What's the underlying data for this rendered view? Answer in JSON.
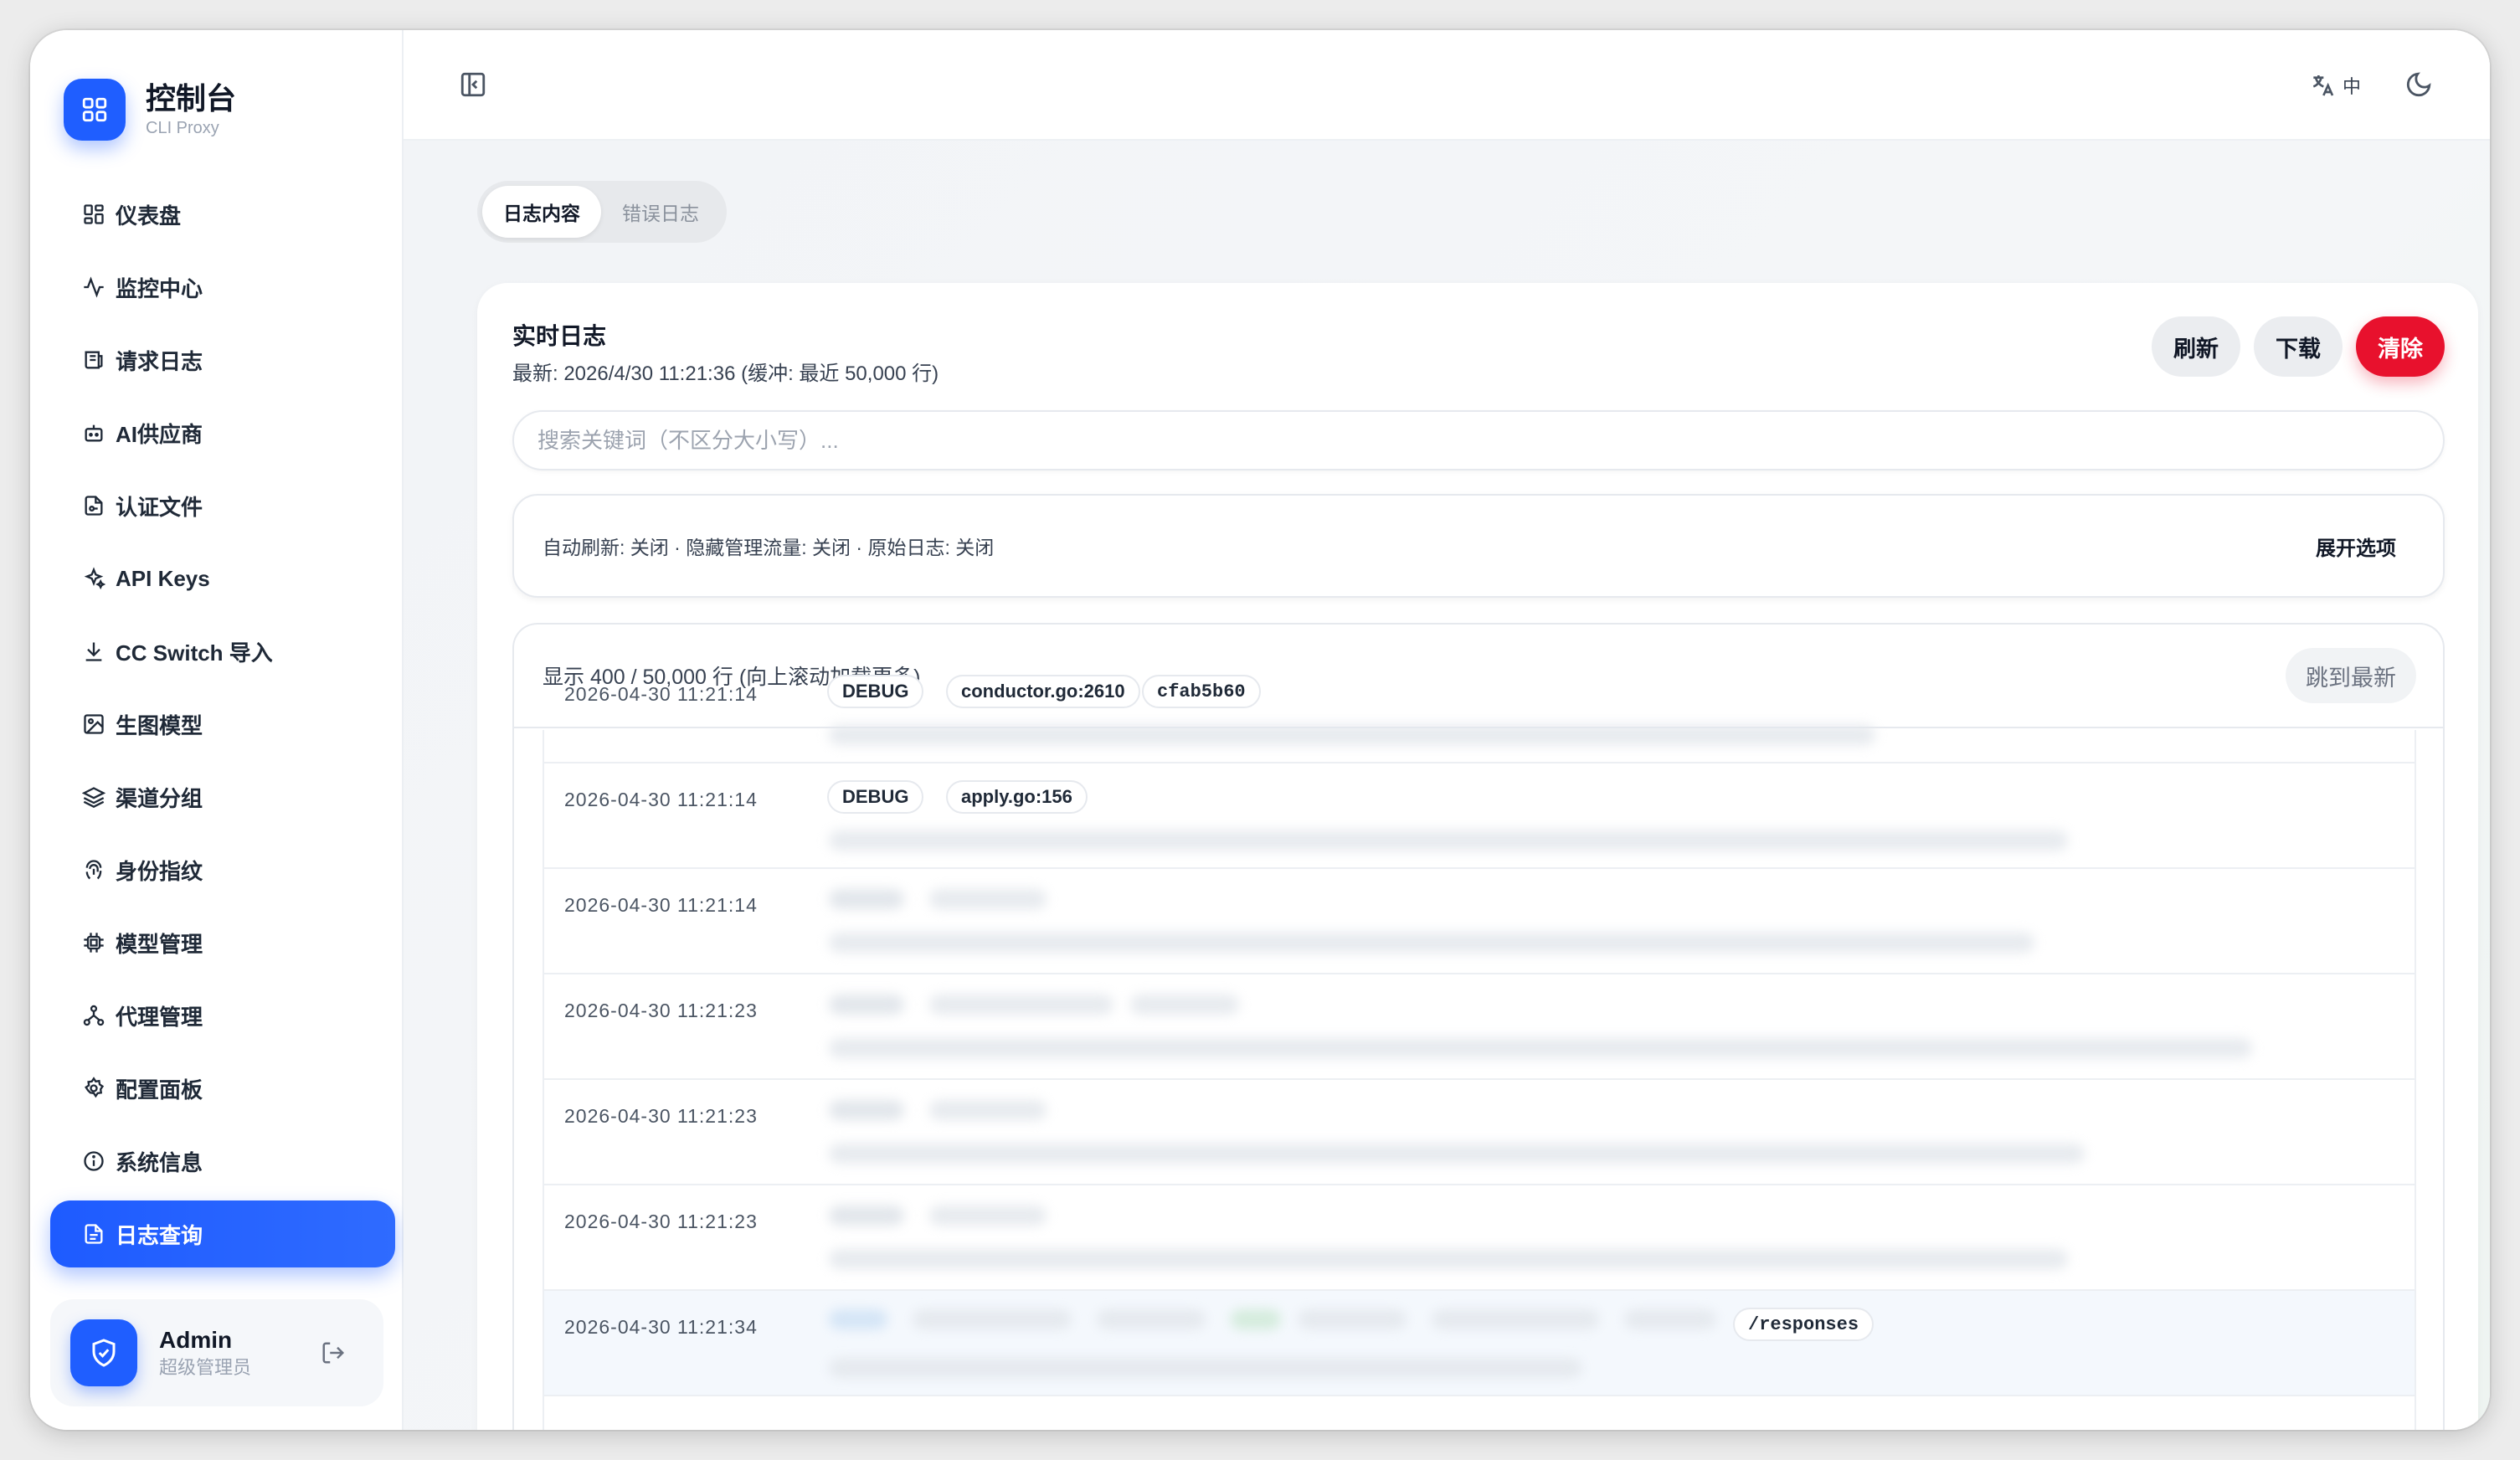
{
  "brand": {
    "title": "控制台",
    "subtitle": "CLI Proxy",
    "logo_icon": "grid-icon",
    "accent": "#1f5eff"
  },
  "sidebar": {
    "items": [
      {
        "label": "仪表盘",
        "icon": "dashboard-icon",
        "active": false
      },
      {
        "label": "监控中心",
        "icon": "activity-icon",
        "active": false
      },
      {
        "label": "请求日志",
        "icon": "request-log-icon",
        "active": false
      },
      {
        "label": "AI供应商",
        "icon": "bot-icon",
        "active": false
      },
      {
        "label": "认证文件",
        "icon": "file-key-icon",
        "active": false
      },
      {
        "label": "API Keys",
        "icon": "sparkles-icon",
        "active": false
      },
      {
        "label": "CC Switch 导入",
        "icon": "download-icon",
        "active": false
      },
      {
        "label": "生图模型",
        "icon": "image-icon",
        "active": false
      },
      {
        "label": "渠道分组",
        "icon": "layers-icon",
        "active": false
      },
      {
        "label": "身份指纹",
        "icon": "fingerprint-icon",
        "active": false
      },
      {
        "label": "模型管理",
        "icon": "cpu-icon",
        "active": false
      },
      {
        "label": "代理管理",
        "icon": "network-icon",
        "active": false
      },
      {
        "label": "配置面板",
        "icon": "gear-icon",
        "active": false
      },
      {
        "label": "系统信息",
        "icon": "info-icon",
        "active": false
      },
      {
        "label": "日志查询",
        "icon": "document-icon",
        "active": true
      }
    ]
  },
  "user": {
    "name": "Admin",
    "role": "超级管理员",
    "avatar_icon": "shield-check-icon",
    "logout_icon": "logout-icon"
  },
  "topbar": {
    "lang_label": "中",
    "lang_icon": "translate-icon",
    "theme_icon": "moon-icon",
    "collapse_icon": "sidebar-toggle-icon"
  },
  "tabs": [
    {
      "label": "日志内容",
      "active": true
    },
    {
      "label": "错误日志",
      "active": false
    }
  ],
  "log_card": {
    "title": "实时日志",
    "subtitle": "最新: 2026/4/30 11:21:36 (缓冲: 最近 50,000 行)",
    "buttons": {
      "refresh": "刷新",
      "download": "下载",
      "clear": "清除"
    },
    "clear_color": "#e8112d",
    "search_placeholder": "搜索关键词（不区分大小写）...",
    "search_value": "",
    "options_summary": "自动刷新: 关闭 · 隐藏管理流量: 关闭 · 原始日志: 关闭",
    "options_toggle": "展开选项",
    "count_text": "显示 400 / 50,000 行 (向上滚动加载更多)",
    "jump_latest": "跳到最新"
  },
  "log_rows": [
    {
      "time": "2026-04-30 11:21:14",
      "tags": [
        "DEBUG",
        "conductor.go:2610",
        "cfab5b60"
      ]
    },
    {
      "time": "2026-04-30 11:21:14",
      "tags": [
        "DEBUG",
        "apply.go:156"
      ]
    },
    {
      "time": "2026-04-30 11:21:14",
      "tags": []
    },
    {
      "time": "2026-04-30 11:21:23",
      "tags": []
    },
    {
      "time": "2026-04-30 11:21:23",
      "tags": []
    },
    {
      "time": "2026-04-30 11:21:23",
      "tags": []
    },
    {
      "time": "2026-04-30 11:21:34",
      "tags": [
        "/responses"
      ]
    }
  ]
}
